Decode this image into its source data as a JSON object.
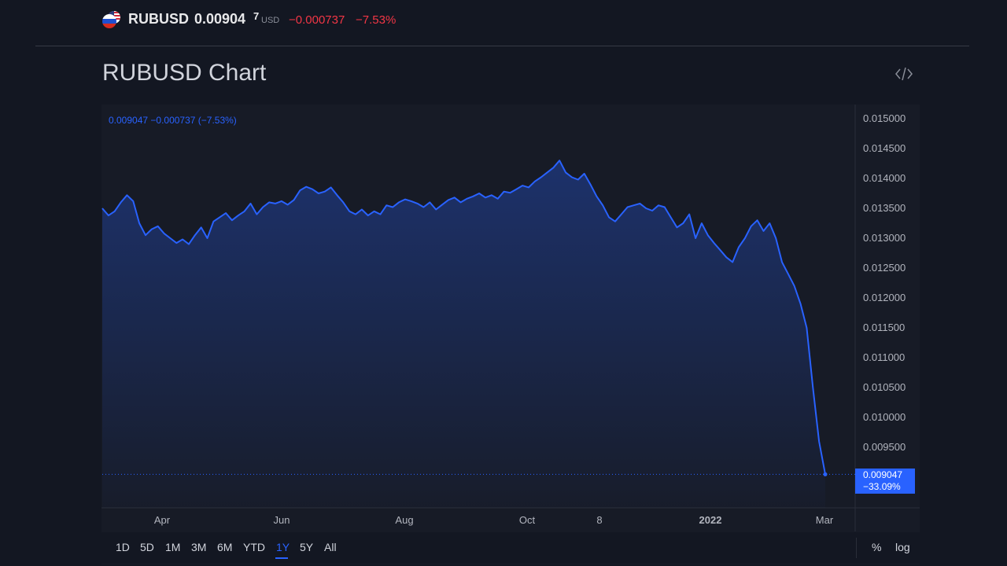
{
  "header": {
    "symbol": "RUBUSD",
    "price": "0.00904",
    "price_last_digit": "7",
    "currency": "USD",
    "change": "−0.000737",
    "change_percent": "−7.53%"
  },
  "page_title": "RUBUSD Chart",
  "legend": "0.009047  −0.000737 (−7.53%)",
  "price_tag": {
    "value": "0.009047",
    "percent": "−33.09%"
  },
  "range_buttons": [
    "1D",
    "5D",
    "1M",
    "3M",
    "6M",
    "YTD",
    "1Y",
    "5Y",
    "All"
  ],
  "active_range": "1Y",
  "right_controls": [
    "%",
    "log"
  ],
  "colors": {
    "line": "#2962ff",
    "negative": "#f23645",
    "background": "#131722"
  },
  "icons": [
    "russia-us-flag-icon",
    "embed-code-icon"
  ],
  "chart_data": {
    "type": "area",
    "title": "",
    "xlabel": "",
    "ylabel": "",
    "x_tick_labels": [
      "Apr",
      "Jun",
      "Aug",
      "Oct",
      "8",
      "2022",
      "Mar"
    ],
    "y_tick_labels": [
      "0.015000",
      "0.014500",
      "0.014000",
      "0.013500",
      "0.013000",
      "0.012500",
      "0.012000",
      "0.011500",
      "0.011000",
      "0.010500",
      "0.010000",
      "0.009500"
    ],
    "ylim": [
      0.0088,
      0.0152
    ],
    "last_value": 0.009047,
    "grid": false,
    "series": [
      {
        "values": [
          0.0135,
          0.01338,
          0.01345,
          0.0136,
          0.01372,
          0.01362,
          0.01325,
          0.01305,
          0.01315,
          0.0132,
          0.01308,
          0.013,
          0.01292,
          0.01298,
          0.0129,
          0.01305,
          0.01318,
          0.013,
          0.01328,
          0.01335,
          0.01342,
          0.0133,
          0.01338,
          0.01345,
          0.01358,
          0.0134,
          0.01352,
          0.0136,
          0.01358,
          0.01362,
          0.01356,
          0.01364,
          0.0138,
          0.01386,
          0.01382,
          0.01375,
          0.01378,
          0.01385,
          0.01372,
          0.0136,
          0.01345,
          0.0134,
          0.01348,
          0.01338,
          0.01345,
          0.0134,
          0.01355,
          0.01352,
          0.0136,
          0.01365,
          0.01362,
          0.01358,
          0.01352,
          0.0136,
          0.01348,
          0.01356,
          0.01364,
          0.01368,
          0.0136,
          0.01366,
          0.0137,
          0.01375,
          0.01368,
          0.01372,
          0.01366,
          0.01378,
          0.01376,
          0.01382,
          0.01388,
          0.01385,
          0.01395,
          0.01402,
          0.0141,
          0.01418,
          0.0143,
          0.0141,
          0.01402,
          0.01398,
          0.01408,
          0.0139,
          0.0137,
          0.01355,
          0.01335,
          0.01328,
          0.0134,
          0.01352,
          0.01355,
          0.01358,
          0.0135,
          0.01346,
          0.01355,
          0.01352,
          0.01335,
          0.01318,
          0.01325,
          0.0134,
          0.013,
          0.01325,
          0.01305,
          0.01292,
          0.0128,
          0.01268,
          0.0126,
          0.01285,
          0.013,
          0.0132,
          0.0133,
          0.01312,
          0.01325,
          0.013,
          0.0126,
          0.0124,
          0.0122,
          0.0119,
          0.0115,
          0.0105,
          0.0096,
          0.009047
        ]
      }
    ]
  }
}
